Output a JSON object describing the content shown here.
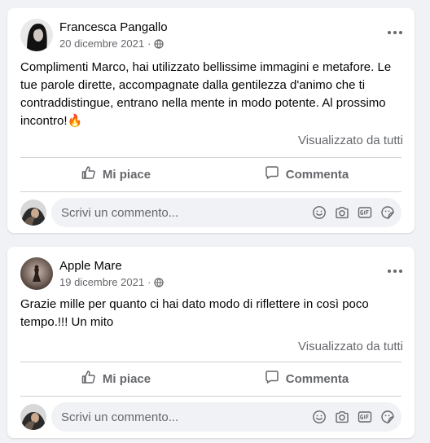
{
  "posts": [
    {
      "author": "Francesca Pangallo",
      "date": "20 dicembre 2021",
      "separator": "·",
      "text": "Complimenti Marco, hai utilizzato bellissime immagini e metafore. Le tue parole dirette, accompagnate dalla gentilezza d'animo che ti contraddistingue, entrano nella mente in modo potente. Al prossimo incontro!🔥",
      "seen": "Visualizzato da tutti",
      "like_label": "Mi piace",
      "comment_label": "Commenta",
      "comment_placeholder": "Scrivi un commento..."
    },
    {
      "author": "Apple Mare",
      "date": "19 dicembre 2021",
      "separator": "·",
      "text": "Grazie mille per quanto ci hai dato modo di riflettere in così poco tempo.!!! Un mito",
      "seen": "Visualizzato da tutti",
      "like_label": "Mi piace",
      "comment_label": "Commenta",
      "comment_placeholder": "Scrivi un commento..."
    }
  ],
  "icons": {
    "privacy": "globe-icon",
    "more": "more-options-icon",
    "like": "thumbs-up-icon",
    "comment": "speech-bubble-icon",
    "emoji": "smiley-icon",
    "camera": "camera-icon",
    "gif": "gif-icon",
    "sticker": "sticker-icon"
  },
  "colors": {
    "background": "#f0f2f5",
    "card": "#ffffff",
    "secondary_text": "#65676b",
    "divider": "#ced0d4"
  }
}
